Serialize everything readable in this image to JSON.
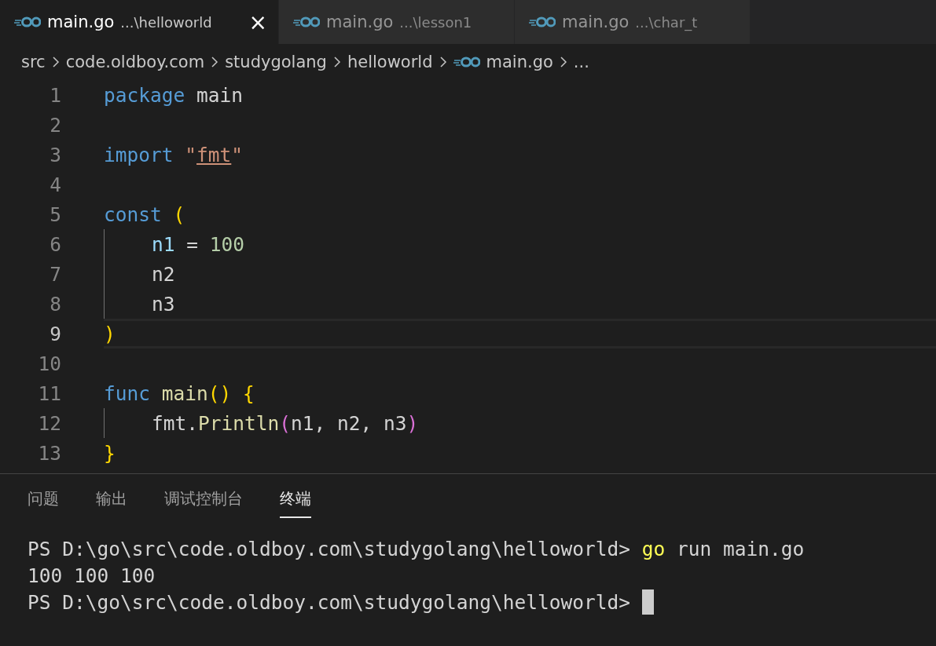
{
  "tabs": [
    {
      "name": "main.go",
      "path": "...\\helloworld",
      "selected": true,
      "close": "×"
    },
    {
      "name": "main.go",
      "path": "...\\lesson1",
      "selected": false
    },
    {
      "name": "main.go",
      "path": "...\\char_t",
      "selected": false
    }
  ],
  "breadcrumb": [
    {
      "text": "src",
      "kind": "folder"
    },
    {
      "text": "code.oldboy.com",
      "kind": "folder"
    },
    {
      "text": "studygolang",
      "kind": "folder"
    },
    {
      "text": "helloworld",
      "kind": "folder"
    },
    {
      "text": "main.go",
      "kind": "file"
    },
    {
      "text": "...",
      "kind": "more"
    }
  ],
  "editor": {
    "lines": [
      {
        "number": "1",
        "current": false,
        "indented": false,
        "tokens": [
          {
            "text": "package",
            "kind": "keyword"
          },
          {
            "text": " main",
            "kind": "plain"
          }
        ]
      },
      {
        "number": "2",
        "current": false,
        "indented": false
      },
      {
        "number": "3",
        "current": false,
        "indented": false,
        "tokens": [
          {
            "text": "import",
            "kind": "keyword"
          },
          {
            "text": " \"",
            "kind": "string"
          },
          {
            "text": "fmt",
            "kind": "link"
          },
          {
            "text": "\"",
            "kind": "string"
          }
        ]
      },
      {
        "number": "4",
        "current": false,
        "indented": false
      },
      {
        "number": "5",
        "current": false,
        "indented": false,
        "tokens": [
          {
            "text": "const",
            "kind": "keyword"
          },
          {
            "text": " (",
            "kind": "bracket"
          }
        ]
      },
      {
        "number": "6",
        "current": false,
        "indented": true,
        "tokens": [
          {
            "text": "n1",
            "kind": "variable"
          },
          {
            "text": " = ",
            "kind": "plain"
          },
          {
            "text": "100",
            "kind": "number"
          }
        ]
      },
      {
        "number": "7",
        "current": false,
        "indented": true,
        "tokens": [
          {
            "text": "n2",
            "kind": "plain"
          }
        ]
      },
      {
        "number": "8",
        "current": false,
        "indented": true,
        "tokens": [
          {
            "text": "n3",
            "kind": "plain"
          }
        ]
      },
      {
        "number": "9",
        "current": true,
        "indented": false,
        "tokens": [
          {
            "text": ")",
            "kind": "bracket"
          }
        ]
      },
      {
        "number": "10",
        "current": false,
        "indented": false
      },
      {
        "number": "11",
        "current": false,
        "indented": false,
        "tokens": [
          {
            "text": "func",
            "kind": "keyword"
          },
          {
            "text": " main",
            "kind": "function"
          },
          {
            "text": "()",
            "kind": "bracket"
          },
          {
            "text": " {",
            "kind": "bracket"
          }
        ]
      },
      {
        "number": "12",
        "current": false,
        "indented": true,
        "tokens": [
          {
            "text": "fmt.",
            "kind": "plain"
          },
          {
            "text": "Println",
            "kind": "function"
          },
          {
            "text": "(",
            "kind": "bracket2"
          },
          {
            "text": "n1, n2, n3",
            "kind": "plain"
          },
          {
            "text": ")",
            "kind": "bracket2"
          }
        ]
      },
      {
        "number": "13",
        "current": false,
        "indented": false,
        "tokens": [
          {
            "text": "}",
            "kind": "bracket"
          }
        ]
      }
    ]
  },
  "panel": {
    "tabs": [
      {
        "label": "问题",
        "selected": false
      },
      {
        "label": "输出",
        "selected": false
      },
      {
        "label": "调试控制台",
        "selected": false
      },
      {
        "label": "终端",
        "selected": true
      }
    ],
    "terminal": [
      {
        "cursor": false,
        "tokens": [
          {
            "text": "PS D:\\go\\src\\code.oldboy.com\\studygolang\\helloworld> ",
            "kind": "plain"
          },
          {
            "text": "go",
            "kind": "command"
          },
          {
            "text": " run main.go",
            "kind": "plain"
          }
        ]
      },
      {
        "cursor": false,
        "tokens": [
          {
            "text": "100 100 100",
            "kind": "plain"
          }
        ]
      },
      {
        "cursor": true,
        "tokens": [
          {
            "text": "PS D:\\go\\src\\code.oldboy.com\\studygolang\\helloworld> ",
            "kind": "plain"
          }
        ]
      }
    ]
  }
}
